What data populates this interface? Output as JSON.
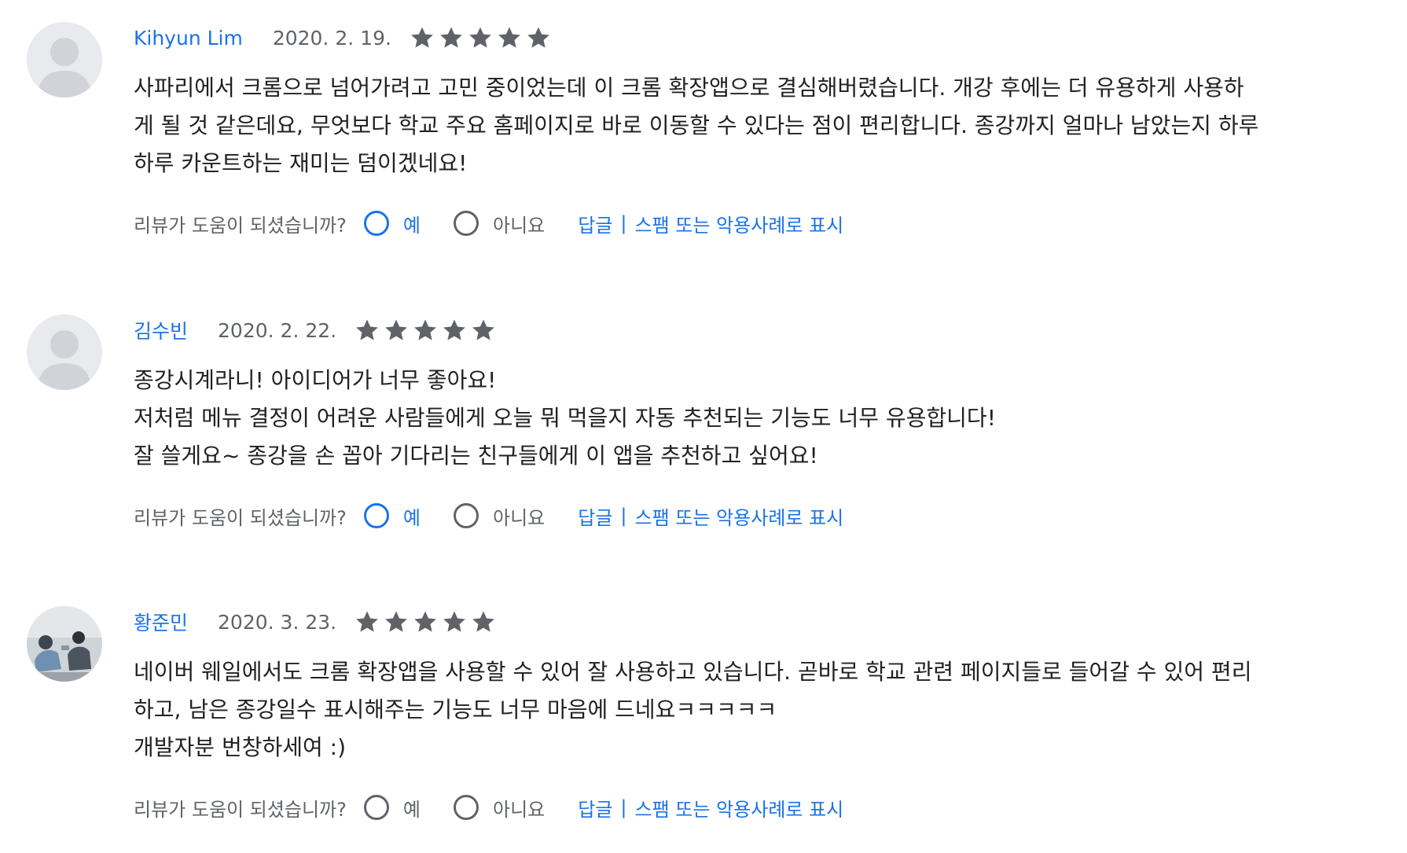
{
  "helpful": {
    "question": "리뷰가 도움이 되셨습니까?",
    "yes_label": "예",
    "no_label": "아니요",
    "reply_label": "답글",
    "separator": "|",
    "report_label": "스팸 또는 악용사례로 표시"
  },
  "colors": {
    "link_blue": "#1a73e8",
    "star_gray": "#5f6368"
  },
  "reviews": [
    {
      "author": "Kihyun Lim",
      "date": "2020. 2. 19.",
      "rating": 5,
      "avatar": "default-person-avatar",
      "selected_helpful": "yes",
      "text_lines": [
        "사파리에서 크롬으로 넘어가려고 고민 중이었는데 이 크롬 확장앱으로 결심해버렸습니다. 개강 후에는 더 유용하게 사용하",
        "게 될 것 같은데요, 무엇보다 학교 주요 홈페이지로 바로 이동할 수 있다는 점이 편리합니다. 종강까지 얼마나 남았는지 하루",
        "하루 카운트하는 재미는 덤이겠네요!"
      ]
    },
    {
      "author": "김수빈",
      "date": "2020. 2. 22.",
      "rating": 5,
      "avatar": "default-person-avatar",
      "selected_helpful": "yes",
      "text_lines": [
        "종강시계라니! 아이디어가 너무 좋아요!",
        "저처럼 메뉴 결정이 어려운 사람들에게 오늘 뭐 먹을지 자동 추천되는 기능도 너무 유용합니다!",
        "잘 쓸게요~ 종강을 손 꼽아 기다리는 친구들에게 이 앱을 추천하고 싶어요!"
      ]
    },
    {
      "author": "황준민",
      "date": "2020. 3. 23.",
      "rating": 5,
      "avatar": "photo-avatar",
      "selected_helpful": "none",
      "text_lines": [
        "네이버 웨일에서도 크롬 확장앱을 사용할 수 있어 잘 사용하고 있습니다. 곧바로 학교 관련 페이지들로 들어갈 수 있어 편리",
        "하고, 남은 종강일수 표시해주는 기능도 너무 마음에 드네요ㅋㅋㅋㅋㅋ",
        "개발자분 번창하세여 :)"
      ]
    }
  ]
}
